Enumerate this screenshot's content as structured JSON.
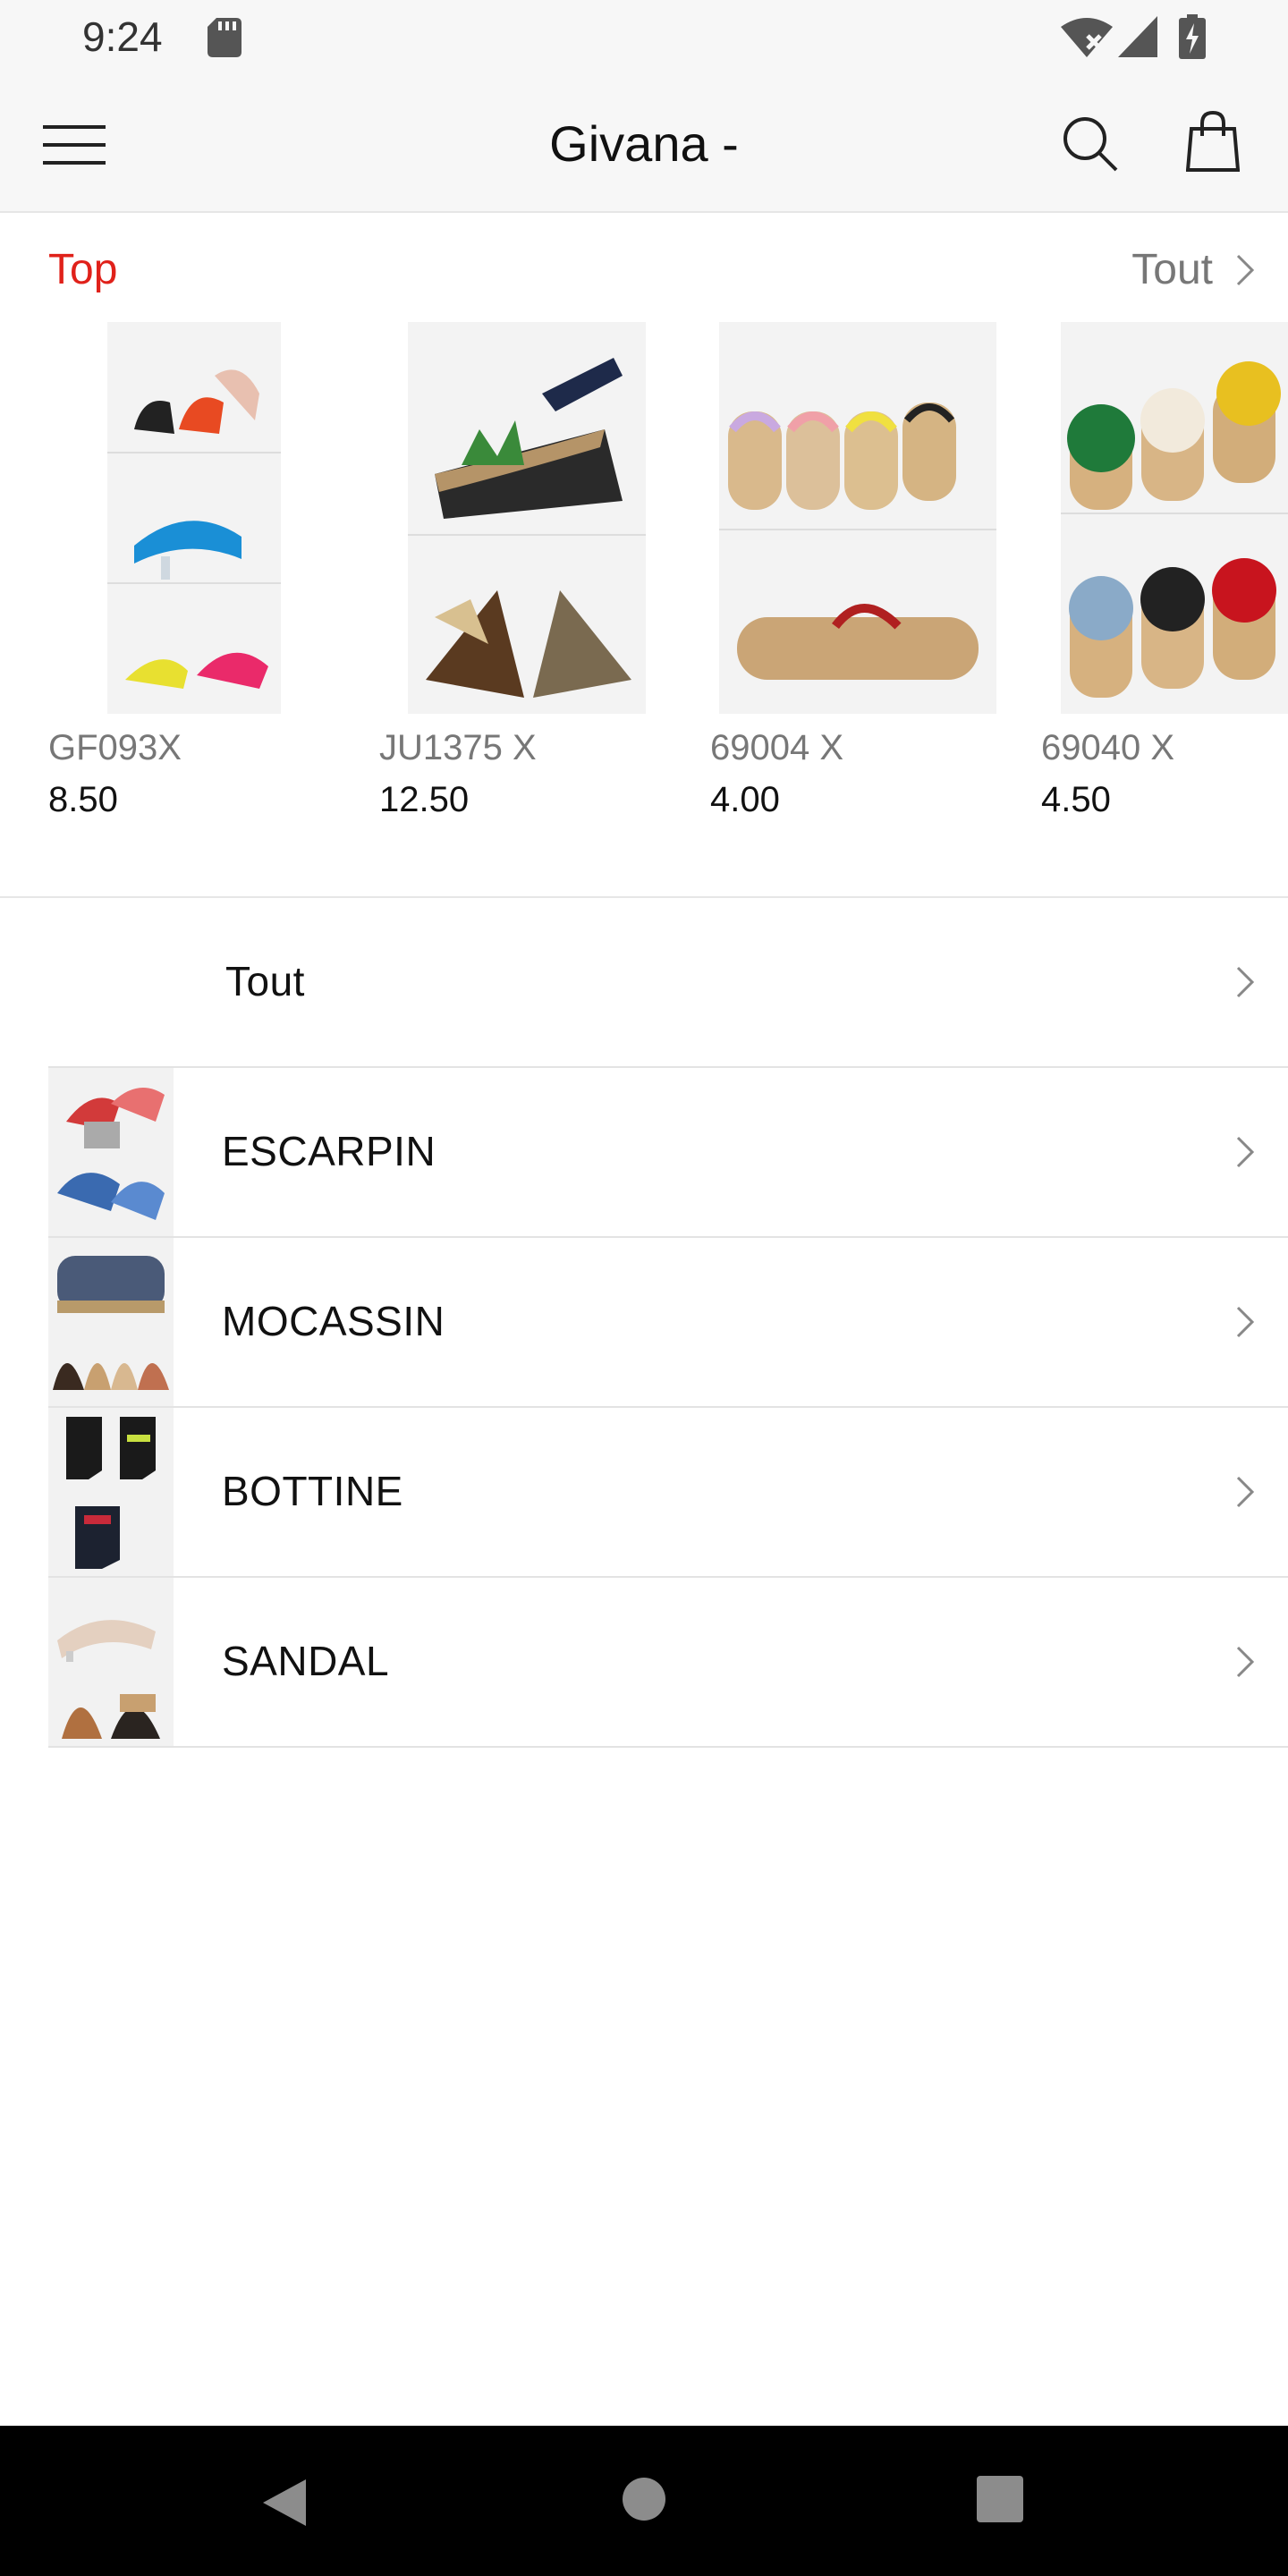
{
  "status_bar": {
    "time": "9:24",
    "icons": [
      "sd-card-icon",
      "wifi-off-icon",
      "cell-signal-icon",
      "battery-charging-icon"
    ]
  },
  "app_bar": {
    "title": "Givana -",
    "icons": [
      "menu-icon",
      "search-icon",
      "shopping-bag-icon"
    ]
  },
  "top_section": {
    "title": "Top",
    "see_all": "Tout",
    "title_color": "#e0211a",
    "products": [
      {
        "name": "GF093X",
        "price": "8.50"
      },
      {
        "name": "JU1375 X",
        "price": "12.50"
      },
      {
        "name": "69004 X",
        "price": "4.00"
      },
      {
        "name": "69040 X",
        "price": "4.50"
      }
    ]
  },
  "categories": {
    "all_label": "Tout",
    "items": [
      {
        "label": "ESCARPIN"
      },
      {
        "label": "MOCASSIN"
      },
      {
        "label": "BOTTINE"
      },
      {
        "label": "SANDAL"
      }
    ]
  },
  "nav_bar": {
    "icons": [
      "back-icon",
      "home-icon",
      "recent-apps-icon"
    ]
  }
}
